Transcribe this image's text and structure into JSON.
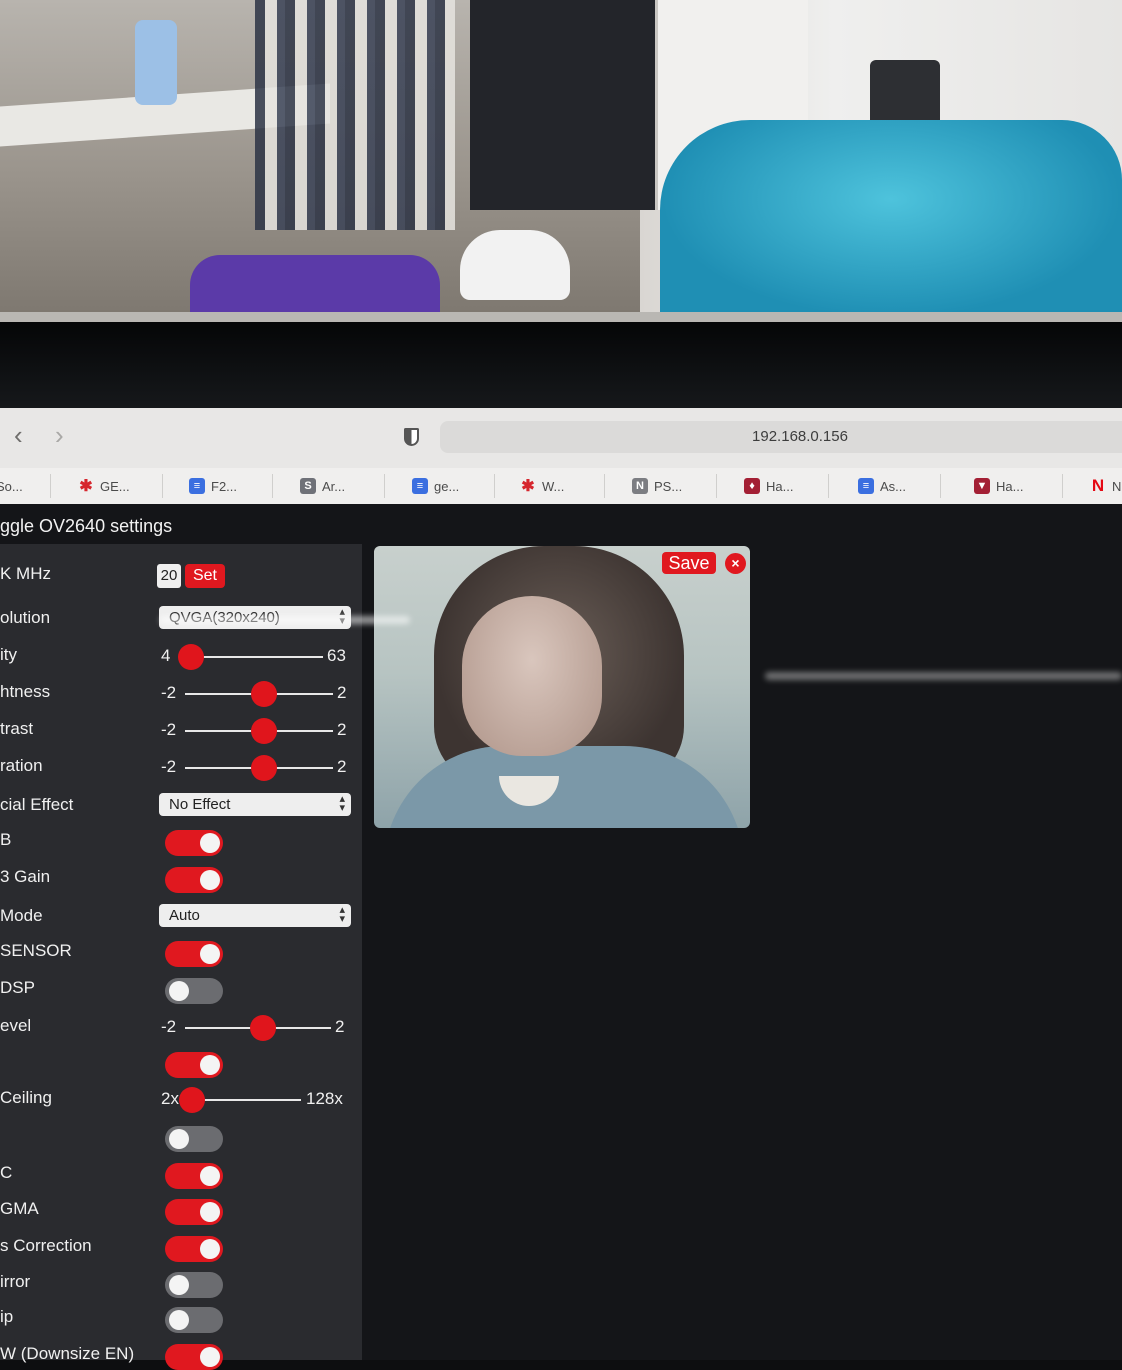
{
  "browser": {
    "url": "192.168.0.156",
    "bookmarks": [
      {
        "label": "So...",
        "icon": ""
      },
      {
        "label": "GE...",
        "icon": "asterisk-red-icon"
      },
      {
        "label": "F2...",
        "icon": "google-docs-icon"
      },
      {
        "label": "Ar...",
        "icon": "s-icon"
      },
      {
        "label": "ge...",
        "icon": "google-docs-icon"
      },
      {
        "label": "W...",
        "icon": "asterisk-red-icon"
      },
      {
        "label": "PS...",
        "icon": "n-icon"
      },
      {
        "label": "Ha...",
        "icon": "shield-crest-icon"
      },
      {
        "label": "As...",
        "icon": "google-docs-icon"
      },
      {
        "label": "Ha...",
        "icon": "harvard-shield-icon"
      },
      {
        "label": "N",
        "icon": "netflix-icon"
      }
    ]
  },
  "menu": {
    "title": "ggle OV2640 settings"
  },
  "controls": {
    "xclk": {
      "label": "K MHz",
      "value": "20",
      "button": "Set"
    },
    "resolution": {
      "label": "olution",
      "value": "QVGA(320x240)"
    },
    "quality": {
      "label": "ity",
      "min": "4",
      "max": "63",
      "level": 0.02
    },
    "brightness": {
      "label": "htness",
      "min": "-2",
      "max": "2",
      "level": 0.5
    },
    "contrast": {
      "label": "trast",
      "min": "-2",
      "max": "2",
      "level": 0.5
    },
    "saturation": {
      "label": "ration",
      "min": "-2",
      "max": "2",
      "level": 0.5
    },
    "special_effect": {
      "label": "cial Effect",
      "value": "No Effect"
    },
    "awb": {
      "label": "B",
      "on": true
    },
    "awb_gain": {
      "label": "3 Gain",
      "on": true
    },
    "wb_mode": {
      "label": "Mode",
      "value": "Auto"
    },
    "aec_sensor": {
      "label": "SENSOR",
      "on": true
    },
    "aec_dsp": {
      "label": "DSP",
      "on": false
    },
    "ae_level": {
      "label": "evel",
      "min": "-2",
      "max": "2",
      "level": 0.5
    },
    "agc": {
      "label": "",
      "on": true
    },
    "gain_ceiling": {
      "label": "Ceiling",
      "min": "2x",
      "max": "128x",
      "level": 0.0
    },
    "bpc": {
      "label": "",
      "on": false
    },
    "wpc": {
      "label": "C",
      "on": true
    },
    "raw_gma": {
      "label": "GMA",
      "on": true
    },
    "lens_correction": {
      "label": "s Correction",
      "on": true
    },
    "h_mirror": {
      "label": "irror",
      "on": false
    },
    "v_flip": {
      "label": "ip",
      "on": false
    },
    "dcw": {
      "label": "W (Downsize EN)",
      "on": true
    }
  },
  "stream": {
    "save_label": "Save",
    "close_label": "×"
  }
}
